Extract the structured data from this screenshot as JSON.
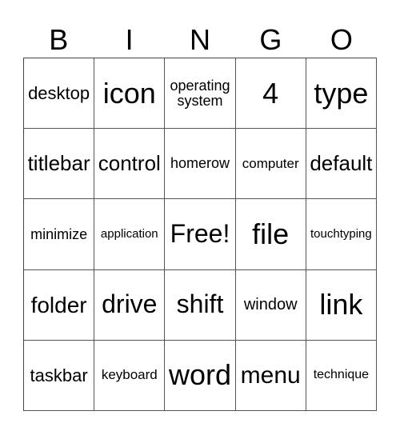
{
  "header": {
    "letters": [
      "B",
      "I",
      "N",
      "G",
      "O"
    ]
  },
  "board": {
    "rows": [
      [
        "desktop",
        "icon",
        "operating system",
        "4",
        "type"
      ],
      [
        "titlebar",
        "control",
        "homerow",
        "computer",
        "default"
      ],
      [
        "minimize",
        "application",
        "Free!",
        "file",
        "touchtyping"
      ],
      [
        "folder",
        "drive",
        "shift",
        "window",
        "link"
      ],
      [
        "taskbar",
        "keyboard",
        "word",
        "menu",
        "technique"
      ]
    ],
    "free_space": "Free!"
  }
}
